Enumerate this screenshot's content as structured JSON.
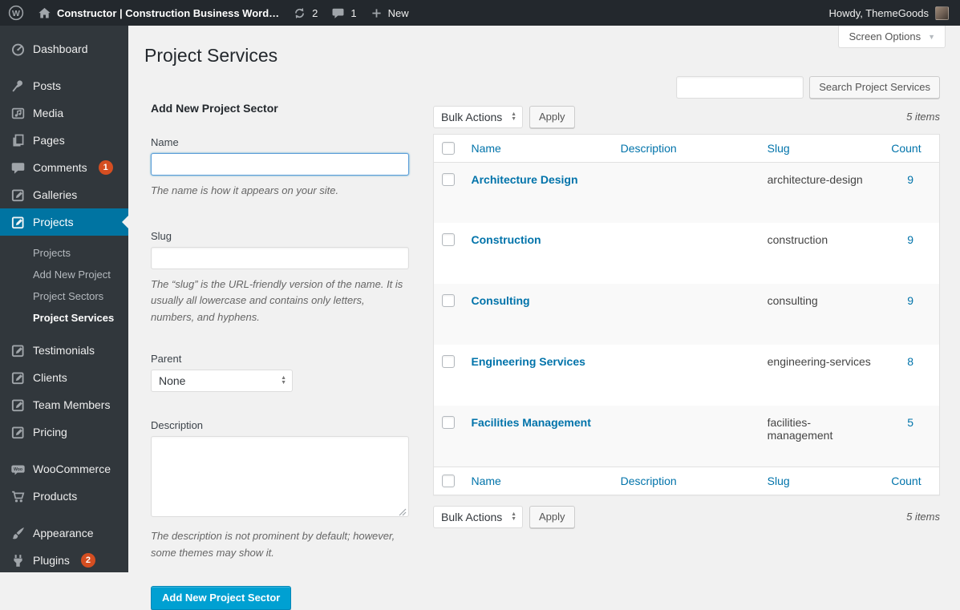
{
  "colors": {
    "accent_blue": "#0074a2",
    "link_blue": "#0073aa",
    "primary_button": "#00a0d2",
    "badge_red": "#d54e21",
    "adminbar_bg": "#23282d",
    "sidebar_bg": "#31373c",
    "content_bg": "#f1f1f1"
  },
  "admin_bar": {
    "site_name": "Constructor | Construction Business Word…",
    "updates_count": "2",
    "comments_count": "1",
    "new_label": "New",
    "howdy": "Howdy, ThemeGoods"
  },
  "screen_options": {
    "label": "Screen Options"
  },
  "sidebar": {
    "items": [
      {
        "label": "Dashboard"
      },
      {
        "label": "Posts"
      },
      {
        "label": "Media"
      },
      {
        "label": "Pages"
      },
      {
        "label": "Comments",
        "badge": "1"
      },
      {
        "label": "Galleries"
      },
      {
        "label": "Projects"
      },
      {
        "label": "Testimonials"
      },
      {
        "label": "Clients"
      },
      {
        "label": "Team Members"
      },
      {
        "label": "Pricing"
      },
      {
        "label": "WooCommerce"
      },
      {
        "label": "Products"
      },
      {
        "label": "Appearance"
      },
      {
        "label": "Plugins",
        "badge": "2"
      }
    ],
    "projects_submenu": [
      {
        "label": "Projects"
      },
      {
        "label": "Add New Project"
      },
      {
        "label": "Project Sectors"
      },
      {
        "label": "Project Services"
      }
    ]
  },
  "page": {
    "title": "Project Services"
  },
  "search": {
    "value": "",
    "button_label": "Search Project Services"
  },
  "form": {
    "heading": "Add New Project Sector",
    "name_label": "Name",
    "name_value": "",
    "name_help": "The name is how it appears on your site.",
    "slug_label": "Slug",
    "slug_value": "",
    "slug_help": "The “slug” is the URL-friendly version of the name. It is usually all lowercase and contains only letters, numbers, and hyphens.",
    "parent_label": "Parent",
    "parent_value": "None",
    "description_label": "Description",
    "description_value": "",
    "description_help": "The description is not prominent by default; however, some themes may show it.",
    "submit_label": "Add New Project Sector"
  },
  "table": {
    "bulk_actions_label": "Bulk Actions",
    "apply_label": "Apply",
    "items_count": "5 items",
    "columns": [
      "Name",
      "Description",
      "Slug",
      "Count"
    ],
    "rows": [
      {
        "name": "Architecture Design",
        "description": "",
        "slug": "architecture-design",
        "count": "9"
      },
      {
        "name": "Construction",
        "description": "",
        "slug": "construction",
        "count": "9"
      },
      {
        "name": "Consulting",
        "description": "",
        "slug": "consulting",
        "count": "9"
      },
      {
        "name": "Engineering Services",
        "description": "",
        "slug": "engineering-services",
        "count": "8"
      },
      {
        "name": "Facilities Management",
        "description": "",
        "slug": "facilities-management",
        "count": "5"
      }
    ]
  }
}
